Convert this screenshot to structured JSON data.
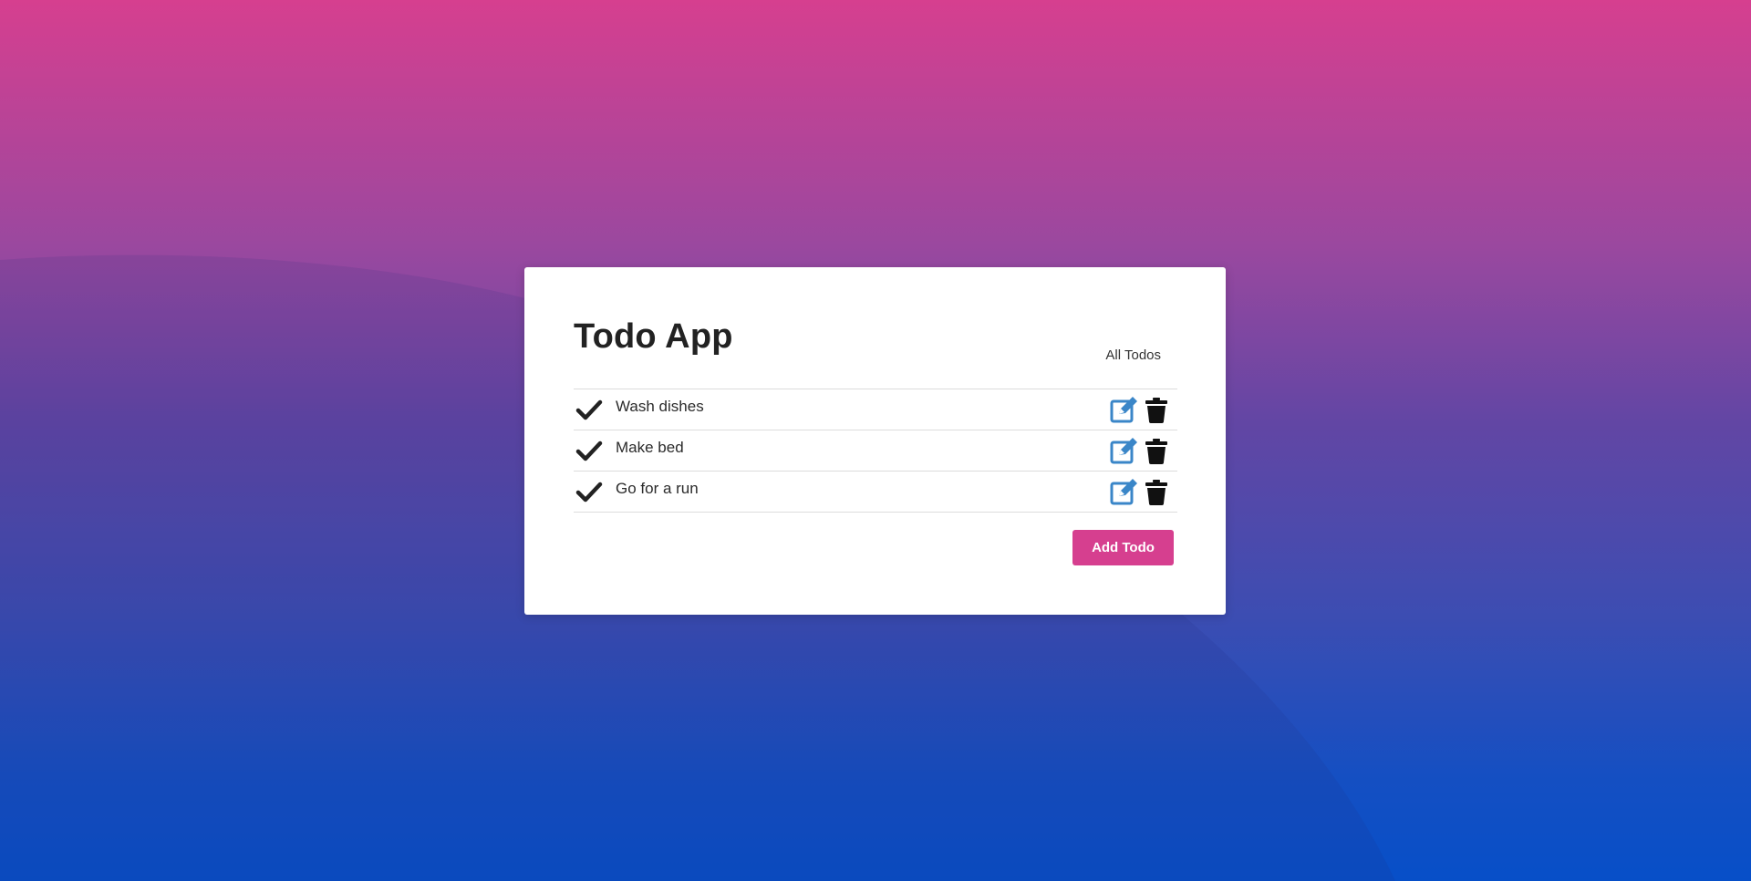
{
  "app": {
    "title": "Todo App",
    "filter_label": "All Todos",
    "add_button_label": "Add Todo"
  },
  "todos": [
    {
      "text": "Wash dishes",
      "completed_icon": "check-icon",
      "edit_icon": "edit-icon",
      "delete_icon": "trash-icon"
    },
    {
      "text": "Make bed",
      "completed_icon": "check-icon",
      "edit_icon": "edit-icon",
      "delete_icon": "trash-icon"
    },
    {
      "text": "Go for a run",
      "completed_icon": "check-icon",
      "edit_icon": "edit-icon",
      "delete_icon": "trash-icon"
    }
  ],
  "colors": {
    "accent": "#d63f8f",
    "edit_icon": "#3a86c8",
    "text": "#222222",
    "background_top": "#d63f8f",
    "background_bottom": "#074fc8"
  }
}
